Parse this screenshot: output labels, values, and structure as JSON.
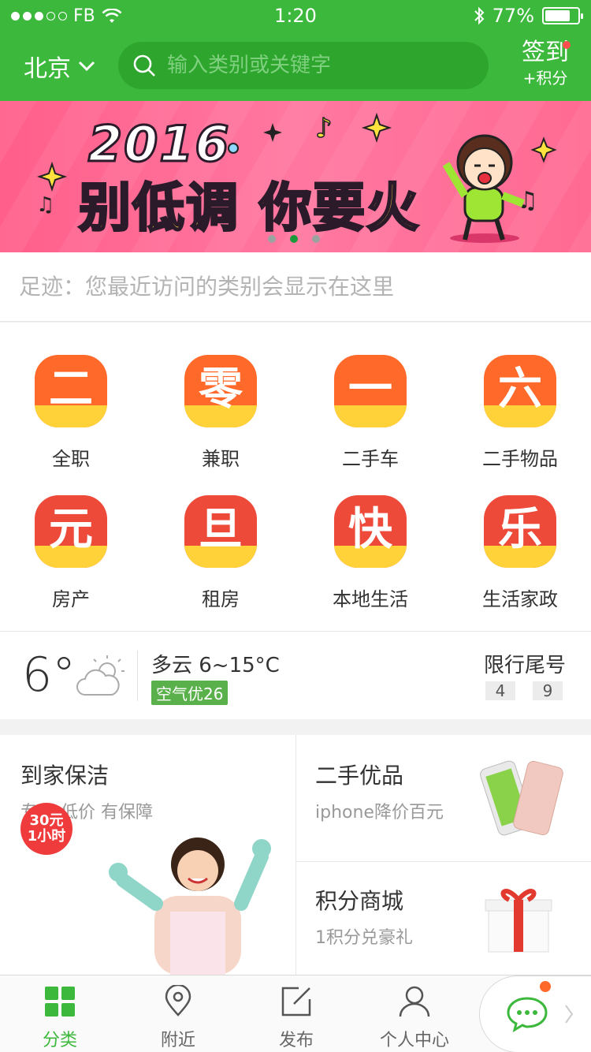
{
  "status_bar": {
    "carrier": "FB",
    "time": "1:20",
    "battery": "77%",
    "battery_fraction": 0.77
  },
  "header": {
    "city": "北京",
    "search_placeholder": "输入类别或关键字",
    "signin_label": "签到",
    "signin_sub": "+积分"
  },
  "banner": {
    "year": "2016",
    "slogan": "别低调 你要火",
    "page_count": 3,
    "active_page": 2
  },
  "footprint": {
    "text": "足迹：您最近访问的类别会显示在这里"
  },
  "categories": [
    {
      "glyph": "二",
      "label": "全职",
      "color": "#ff6a2a"
    },
    {
      "glyph": "零",
      "label": "兼职",
      "color": "#ff6a2a"
    },
    {
      "glyph": "一",
      "label": "二手车",
      "color": "#ff6a2a"
    },
    {
      "glyph": "六",
      "label": "二手物品",
      "color": "#ff6a2a"
    },
    {
      "glyph": "元",
      "label": "房产",
      "color": "#ee4a3a"
    },
    {
      "glyph": "旦",
      "label": "租房",
      "color": "#ee4a3a"
    },
    {
      "glyph": "快",
      "label": "本地生活",
      "color": "#ee4a3a"
    },
    {
      "glyph": "乐",
      "label": "生活家政",
      "color": "#ee4a3a"
    }
  ],
  "weather": {
    "temp": "6°",
    "desc": "多云 6~15°C",
    "aqi": "空气优26",
    "limit_title": "限行尾号",
    "limit_numbers": [
      "4",
      "9"
    ]
  },
  "promo": {
    "cleaning": {
      "title": "到家保洁",
      "sub": "专业 低价 有保障",
      "price_line1": "30元",
      "price_line2": "1小时"
    },
    "secondhand": {
      "title": "二手优品",
      "sub": "iphone降价百元"
    },
    "points": {
      "title": "积分商城",
      "sub": "1积分兑豪礼"
    }
  },
  "tabbar": {
    "items": [
      {
        "label": "分类",
        "icon": "grid-icon"
      },
      {
        "label": "附近",
        "icon": "location-icon"
      },
      {
        "label": "发布",
        "icon": "edit-icon"
      },
      {
        "label": "个人中心",
        "icon": "user-icon"
      }
    ],
    "active_index": 0,
    "chat_icon": "chat-icon"
  },
  "colors": {
    "brand_green": "#3cb93c",
    "banner_pink": "#ff6a92",
    "badge_red": "#ef3b3b"
  }
}
